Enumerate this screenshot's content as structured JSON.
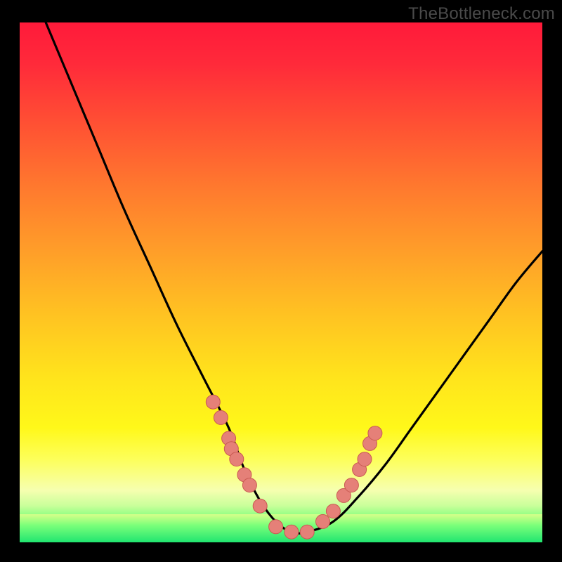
{
  "watermark": "TheBottleneck.com",
  "colors": {
    "page_bg": "#000000",
    "gradient_top": "#ff1a3a",
    "gradient_mid": "#ffe31c",
    "gradient_bottom": "#1fe36f",
    "curve_stroke": "#000000",
    "dot_fill": "#e58078",
    "dot_stroke": "#c95a52"
  },
  "chart_data": {
    "type": "line",
    "title": "",
    "xlabel": "",
    "ylabel": "",
    "xlim": [
      0,
      100
    ],
    "ylim": [
      0,
      100
    ],
    "series": [
      {
        "name": "bottleneck-curve",
        "x": [
          5,
          10,
          15,
          20,
          25,
          30,
          35,
          40,
          43,
          46,
          49,
          52,
          55,
          60,
          65,
          70,
          75,
          80,
          85,
          90,
          95,
          100
        ],
        "values": [
          100,
          88,
          76,
          64,
          53,
          42,
          32,
          22,
          14,
          8,
          4,
          2,
          2,
          4,
          9,
          15,
          22,
          29,
          36,
          43,
          50,
          56
        ]
      }
    ],
    "markers": {
      "name": "highlighted-points",
      "x": [
        37,
        38.5,
        40,
        40.5,
        41.5,
        43,
        44,
        46,
        49,
        52,
        55,
        58,
        60,
        62,
        63.5,
        65,
        66,
        67,
        68
      ],
      "values": [
        27,
        24,
        20,
        18,
        16,
        13,
        11,
        7,
        3,
        2,
        2,
        4,
        6,
        9,
        11,
        14,
        16,
        19,
        21
      ]
    }
  }
}
